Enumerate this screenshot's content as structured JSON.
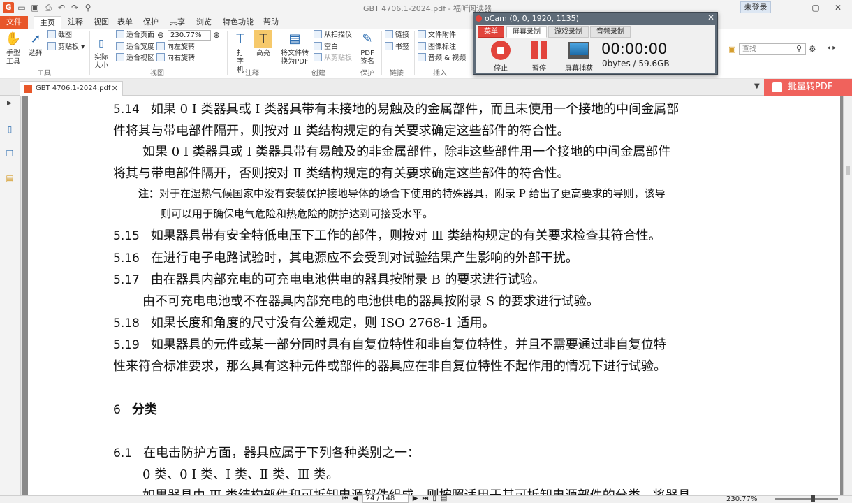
{
  "app": {
    "title": "GBT 4706.1-2024.pdf - 福昕阅读器",
    "login_label": "未登录",
    "search_placeholder": "查找"
  },
  "menu_tabs": [
    "文件",
    "主页",
    "注释",
    "视图",
    "表单",
    "保护",
    "共享",
    "浏览",
    "特色功能",
    "帮助"
  ],
  "ribbon": {
    "tools": {
      "hand": "手型工具",
      "select": "选择",
      "snapshot": "截图",
      "clipboard": "剪贴板",
      "group": "工具"
    },
    "view": {
      "actual_size": "实际大小",
      "fit_page": "适合页面",
      "fit_width": "适合宽度",
      "fit_view": "适合视区",
      "zoom": "230.77%",
      "rotate_left": "向左旋转",
      "rotate_right": "向右旋转",
      "group": "视图"
    },
    "annot": {
      "typewriter": "打字机",
      "highlight": "高亮",
      "group": "注释"
    },
    "create": {
      "to_pdf": "将文件转换为PDF",
      "from_scanner": "从扫描仪",
      "blank": "空白",
      "from_clipboard": "从剪贴板",
      "group": "创建"
    },
    "protect": {
      "sign": "PDF签名",
      "group": "保护"
    },
    "link": {
      "link": "链接",
      "bookmark": "书签",
      "group": "链接"
    },
    "insert": {
      "attachment": "文件附件",
      "image": "图像标注",
      "audio_video": "音频 & 视频",
      "group": "插入"
    }
  },
  "ocam": {
    "title": "oCam (0, 0, 1920, 1135)",
    "tabs": [
      "菜单",
      "屏幕录制",
      "游戏录制",
      "音频录制"
    ],
    "stop": "停止",
    "pause": "暂停",
    "capture": "屏幕捕获",
    "time": "00:00:00",
    "size": "0bytes / 59.6GB"
  },
  "doc_tab": "GBT 4706.1-2024.pdf",
  "batch_button": "批量转PDF",
  "content": {
    "l1_num": "5.14",
    "l1": "如果 0 Ⅰ 类器具或 Ⅰ 类器具带有未接地的易触及的金属部件，而且未使用一个接地的中间金属部",
    "l2": "件将其与带电部件隔开，则按对 Ⅱ 类结构规定的有关要求确定这些部件的符合性。",
    "l3": "如果 0 Ⅰ 类器具或 Ⅰ 类器具带有易触及的非金属部件，除非这些部件用一个接地的中间金属部件",
    "l4": "将其与带电部件隔开，否则按对 Ⅱ 类结构规定的有关要求确定这些部件的符合性。",
    "note_label": "注：",
    "note1": "对于在湿热气候国家中没有安装保护接地导体的场合下使用的特殊器具，附录 P 给出了更高要求的导则，该导",
    "note2": "则可以用于确保电气危险和热危险的防护达到可接受水平。",
    "l515_num": "5.15",
    "l515": "如果器具带有安全特低电压下工作的部件，则按对 Ⅲ 类结构规定的有关要求检查其符合性。",
    "l516_num": "5.16",
    "l516": "在进行电子电路试验时，其电源应不会受到对试验结果产生影响的外部干扰。",
    "l517_num": "5.17",
    "l517": "由在器具内部充电的可充电电池供电的器具按附录 B 的要求进行试验。",
    "l517b": "由不可充电电池或不在器具内部充电的电池供电的器具按附录 S 的要求进行试验。",
    "l518_num": "5.18",
    "l518": "如果长度和角度的尺寸没有公差规定，则 ISO 2768-1 适用。",
    "l519_num": "5.19",
    "l519": "如果器具的元件或某一部分同时具有自复位特性和非自复位特性，并且不需要通过非自复位特",
    "l519b": "性来符合标准要求，那么具有这种元件或部件的器具应在非自复位特性不起作用的情况下进行试验。",
    "h6_num": "6",
    "h6": "分类",
    "l61_num": "6.1",
    "l61": "在电击防护方面，器具应属于下列各种类别之一：",
    "l61b": "0 类、0 Ⅰ 类、Ⅰ 类、Ⅱ 类、Ⅲ 类。",
    "l61c": "如果器具由 Ⅲ 类结构部件和可拆卸电源部件组成，则按照适用于其可拆卸电源部件的分类，将器具"
  },
  "status": {
    "page": "24 / 148",
    "zoom": "230.77%"
  }
}
